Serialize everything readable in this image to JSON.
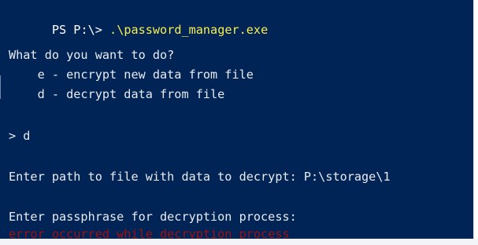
{
  "terminal": {
    "prompt": "PS P:\\>",
    "command": ".\\password_manager.exe",
    "question": "What do you want to do?",
    "options": [
      "    e - encrypt new data from file",
      "    d - decrypt data from file"
    ],
    "input": "> d",
    "path_prompt": "Enter path to file with data to decrypt: P:\\storage\\1",
    "passphrase_prompt": "Enter passphrase for decryption process:",
    "error_message": "error occurred while decryption process"
  }
}
